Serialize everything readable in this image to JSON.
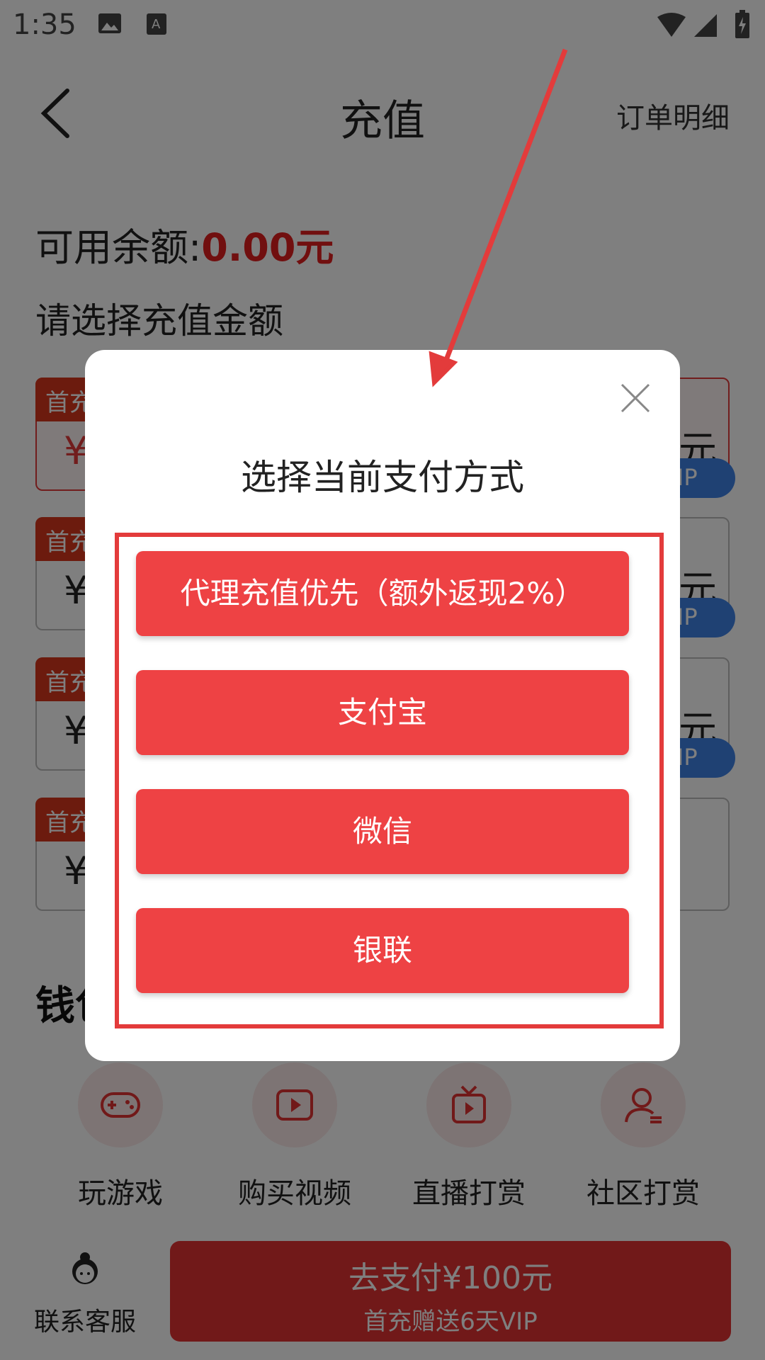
{
  "status_bar": {
    "time": "1:35"
  },
  "header": {
    "title": "充值",
    "orders_link": "订单明细"
  },
  "balance": {
    "label": "可用余额:",
    "amount": "0.00元"
  },
  "select_label": "请选择充值金额",
  "cards": [
    {
      "tag": "首充",
      "yen": "¥",
      "unit": "元",
      "vip": "VIP"
    },
    {
      "tag": "首充",
      "yen": "¥",
      "unit": "元",
      "vip": "VIP"
    },
    {
      "tag": "首充",
      "yen": "¥",
      "unit": "元",
      "vip": "VIP"
    },
    {
      "tag": "首充",
      "yen": "¥"
    }
  ],
  "wallet_title": "钱包",
  "features": [
    {
      "label": "玩游戏",
      "icon": "gamepad-icon"
    },
    {
      "label": "购买视频",
      "icon": "play-icon"
    },
    {
      "label": "直播打赏",
      "icon": "tv-icon"
    },
    {
      "label": "社区打赏",
      "icon": "user-icon"
    }
  ],
  "bottom": {
    "service_label": "联系客服",
    "pay_main": "去支付¥100元",
    "pay_sub": "首充赠送6天VIP"
  },
  "modal": {
    "title": "选择当前支付方式",
    "options": [
      "代理充值优先（额外返现2%）",
      "支付宝",
      "微信",
      "银联"
    ]
  },
  "colors": {
    "accent": "#ee4244",
    "vip_blue": "#3f82e6",
    "tag_red": "#d9371d"
  }
}
